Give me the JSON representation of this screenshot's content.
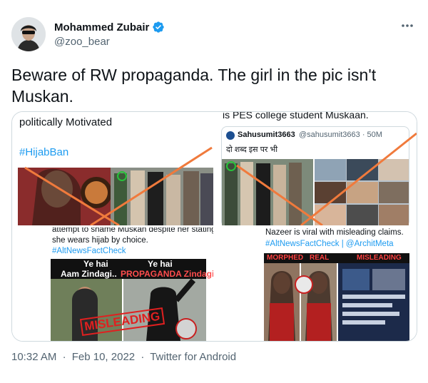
{
  "user": {
    "display_name": "Mohammed Zubair",
    "handle": "@zoo_bear",
    "verified": true,
    "avatar_icon": "profile-avatar"
  },
  "more_icon": "more-horizontal-icon",
  "tweet": {
    "text": "Beware of RW propaganda. The girl in the pic isn't Muskan."
  },
  "media": {
    "panel1": {
      "line1": "politically Motivated",
      "hashtag": "#HijabBan"
    },
    "panel2": {
      "top_text": "is PES college student Muskaan.",
      "embed_name": "Sahusumit3663",
      "embed_handle": "@sahusumit3663 · 50M",
      "embed_text": "दो शब्द इस पर भी"
    },
    "panel3": {
      "line1": "attempt to shame Muskan despite her stating",
      "line2": "she wears hijab by choice.",
      "hashtag": "#AltNewsFactCheck",
      "label_left_1": "Ye hai",
      "label_left_2": "Aam Zindagi..",
      "label_right_1": "Ye hai",
      "label_right_2": "PROPAGANDA Zindagi",
      "stamp": "MISLEADING"
    },
    "panel4": {
      "line1": "Nazeer is viral with misleading claims.",
      "hashtags": "#AltNewsFactCheck | @ArchitMeta",
      "label_1": "MORPHED",
      "label_2": "REAL",
      "label_3": "MISLEADING"
    }
  },
  "footer": {
    "time": "10:32 AM",
    "date": "Feb 10, 2022",
    "source": "Twitter for Android",
    "separator": "·"
  },
  "colors": {
    "accent": "#1d9bf0",
    "cross": "#f07a3c",
    "text": "#0f1419",
    "muted": "#536471"
  }
}
